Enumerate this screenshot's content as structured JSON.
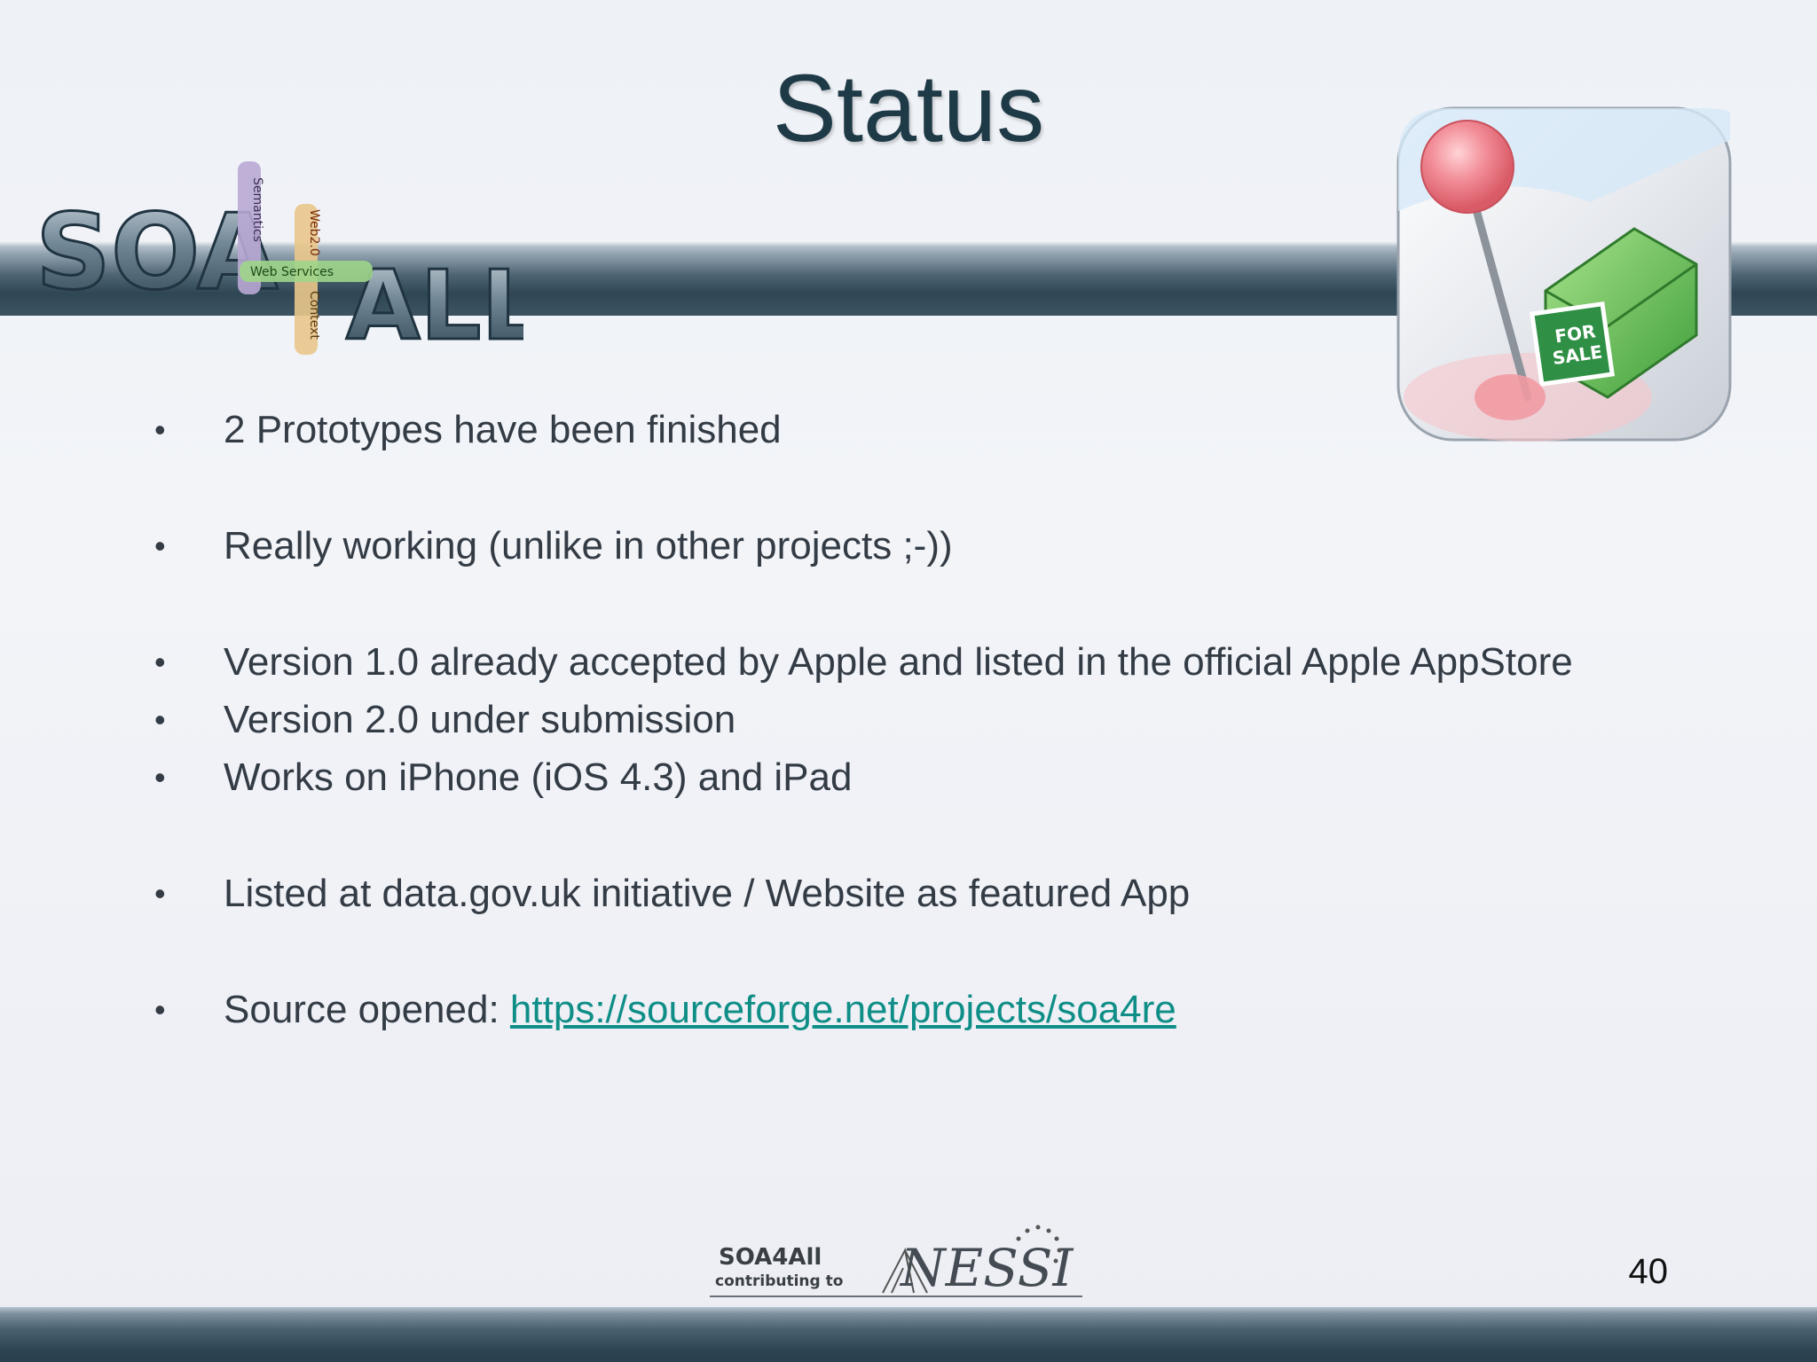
{
  "slide": {
    "title": "Status",
    "page_number": "40"
  },
  "logo": {
    "soa": "SOA",
    "all": "ALL",
    "semantics": "Semantics",
    "web20": "Web2.0",
    "web_services": "Web Services",
    "context": "Context"
  },
  "app_icon": {
    "sign_line1": "FOR",
    "sign_line2": "SALE"
  },
  "bullets": [
    {
      "text": "2 Prototypes have been finished"
    },
    {
      "text": "Really working (unlike in other projects ;-))"
    },
    {
      "text": "Version 1.0 already accepted by Apple and listed in the official Apple AppStore"
    },
    {
      "text": "Version 2.0 under submission"
    },
    {
      "text": "Works on iPhone (iOS 4.3) and iPad"
    },
    {
      "text": "Listed at data.gov.uk initiative / Website as featured App"
    },
    {
      "text": "Source opened: ",
      "link": "https://sourceforge.net/projects/soa4re"
    }
  ],
  "bullet_symbol": "•",
  "footer_logo": {
    "line1": "SOA4All",
    "line2": "contributing to",
    "nessi": "NESSI"
  },
  "colors": {
    "title": "#1f3a47",
    "body_text": "#333b45",
    "link": "#0f8e87",
    "band_dark": "#2f4654"
  }
}
